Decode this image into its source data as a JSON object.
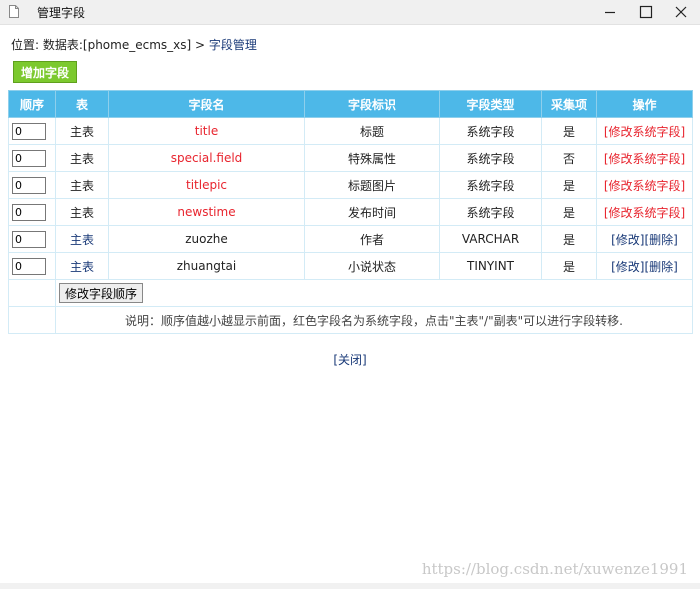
{
  "window": {
    "title": "管理字段"
  },
  "location": {
    "prefix": "位置: 数据表:[phome_ecms_xs] > ",
    "link": "字段管理"
  },
  "toolbar": {
    "add_label": "增加字段"
  },
  "table": {
    "headers": [
      "顺序",
      "表",
      "字段名",
      "字段标识",
      "字段类型",
      "采集项",
      "操作"
    ],
    "rows": [
      {
        "order": "0",
        "table": "主表",
        "field": "title",
        "label": "标题",
        "type": "系统字段",
        "collect": "是",
        "op": "[修改系统字段]",
        "system": true
      },
      {
        "order": "0",
        "table": "主表",
        "field": "special.field",
        "label": "特殊属性",
        "type": "系统字段",
        "collect": "否",
        "op": "[修改系统字段]",
        "system": true
      },
      {
        "order": "0",
        "table": "主表",
        "field": "titlepic",
        "label": "标题图片",
        "type": "系统字段",
        "collect": "是",
        "op": "[修改系统字段]",
        "system": true
      },
      {
        "order": "0",
        "table": "主表",
        "field": "newstime",
        "label": "发布时间",
        "type": "系统字段",
        "collect": "是",
        "op": "[修改系统字段]",
        "system": true
      },
      {
        "order": "0",
        "table": "主表",
        "field": "zuozhe",
        "label": "作者",
        "type": "VARCHAR",
        "collect": "是",
        "op_edit": "[修改]",
        "op_delete": "[删除]",
        "system": false
      },
      {
        "order": "0",
        "table": "主表",
        "field": "zhuangtai",
        "label": "小说状态",
        "type": "TINYINT",
        "collect": "是",
        "op_edit": "[修改]",
        "op_delete": "[删除]",
        "system": false
      }
    ],
    "order_button": "修改字段顺序",
    "note": "说明：顺序值越小越显示前面，红色字段名为系统字段，点击\"主表\"/\"副表\"可以进行字段转移."
  },
  "footer": {
    "close_label": "[关闭]"
  },
  "watermark": "https://blog.csdn.net/xuwenze1991",
  "colors": {
    "header_bg": "#4db8e8",
    "add_button_bg": "#7cc92e",
    "system_field": "#e8242e",
    "link": "#1a3a78"
  }
}
